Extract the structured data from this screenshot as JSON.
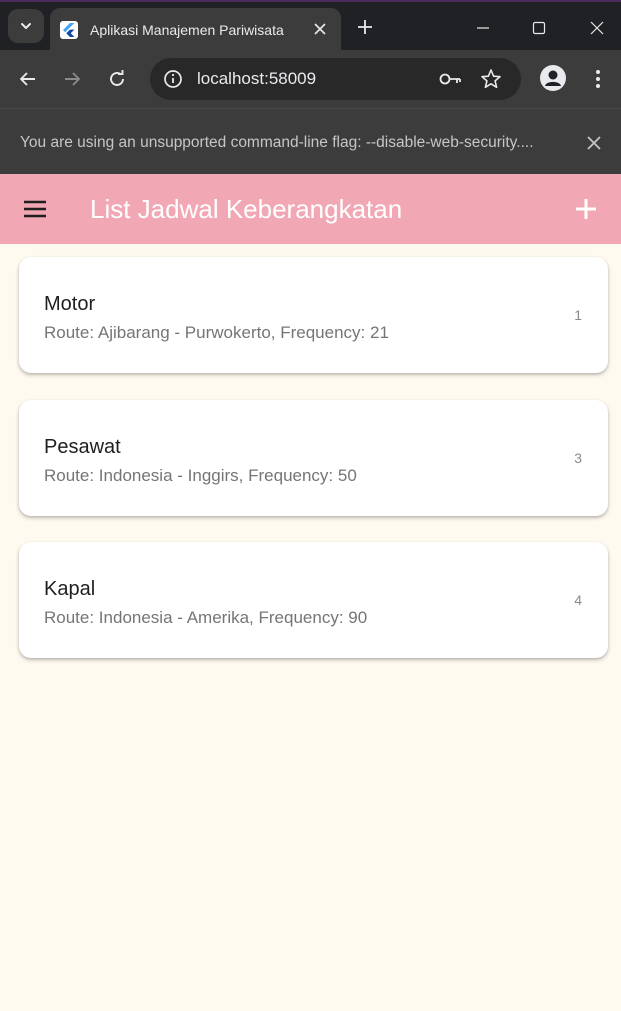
{
  "browser": {
    "tab_title": "Aplikasi Manajemen Pariwisata",
    "url": "localhost:58009",
    "infobar_message": "You are using an unsupported command-line flag: --disable-web-security...."
  },
  "appbar": {
    "title": "List Jadwal Keberangkatan",
    "color": "#f2a7b4"
  },
  "schedules": [
    {
      "title": "Motor",
      "subtitle": "Route: Ajibarang - Purwokerto, Frequency: 21",
      "trailing": "1"
    },
    {
      "title": "Pesawat",
      "subtitle": "Route: Indonesia - Inggirs, Frequency: 50",
      "trailing": "3"
    },
    {
      "title": "Kapal",
      "subtitle": "Route: Indonesia - Amerika, Frequency: 90",
      "trailing": "4"
    }
  ],
  "icons": {
    "menu": "hamburger-menu-icon",
    "add": "plus-icon"
  }
}
